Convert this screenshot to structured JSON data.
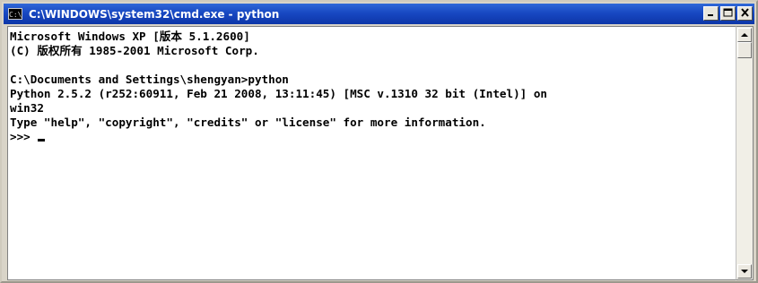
{
  "window": {
    "title": "C:\\WINDOWS\\system32\\cmd.exe - python",
    "icon_label": "C:\\",
    "minimize_icon": "minimize-icon",
    "maximize_icon": "maximize-icon",
    "close_icon": "close-icon"
  },
  "console": {
    "lines": [
      "Microsoft Windows XP [版本 5.1.2600]",
      "(C) 版权所有 1985-2001 Microsoft Corp.",
      "",
      "C:\\Documents and Settings\\shengyan>python",
      "Python 2.5.2 (r252:60911, Feb 21 2008, 13:11:45) [MSC v.1310 32 bit (Intel)] on",
      "win32",
      "Type \"help\", \"copyright\", \"credits\" or \"license\" for more information.",
      ">>> "
    ]
  },
  "scrollbar": {
    "up_icon": "scroll-up-arrow-icon",
    "down_icon": "scroll-down-arrow-icon"
  },
  "colors": {
    "title_bar": "#1848c2",
    "console_bg": "#ffffff",
    "console_text": "#000000"
  }
}
